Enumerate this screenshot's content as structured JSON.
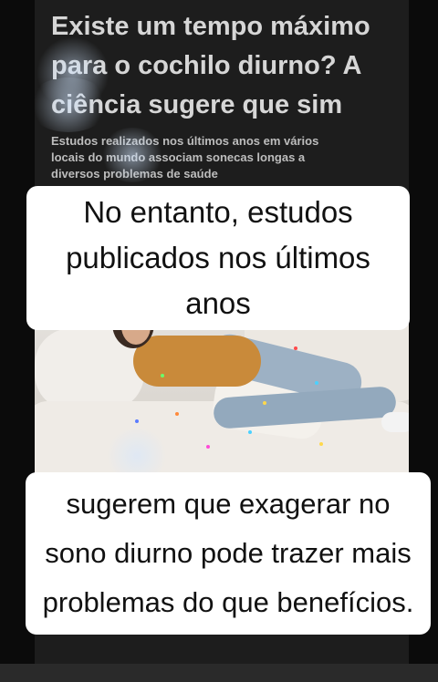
{
  "article": {
    "headline": "Existe um tempo máximo para o cochilo diurno? A ciência sugere que sim",
    "subheadline": "Estudos realizados nos últimos anos em vários locais do mundo associam sonecas longas a diversos problemas de saúde"
  },
  "captions": {
    "top": "No entanto, estudos publicados nos últimos anos",
    "bottom": "sugerem que exagerar no sono diurno pode trazer mais problemas do que benefícios."
  },
  "colors": {
    "caption_bg": "#ffffff",
    "caption_text": "#111111",
    "headline": "#d6d6d6"
  },
  "icons": {
    "photo": "sleeping-woman-on-sofa-image"
  }
}
